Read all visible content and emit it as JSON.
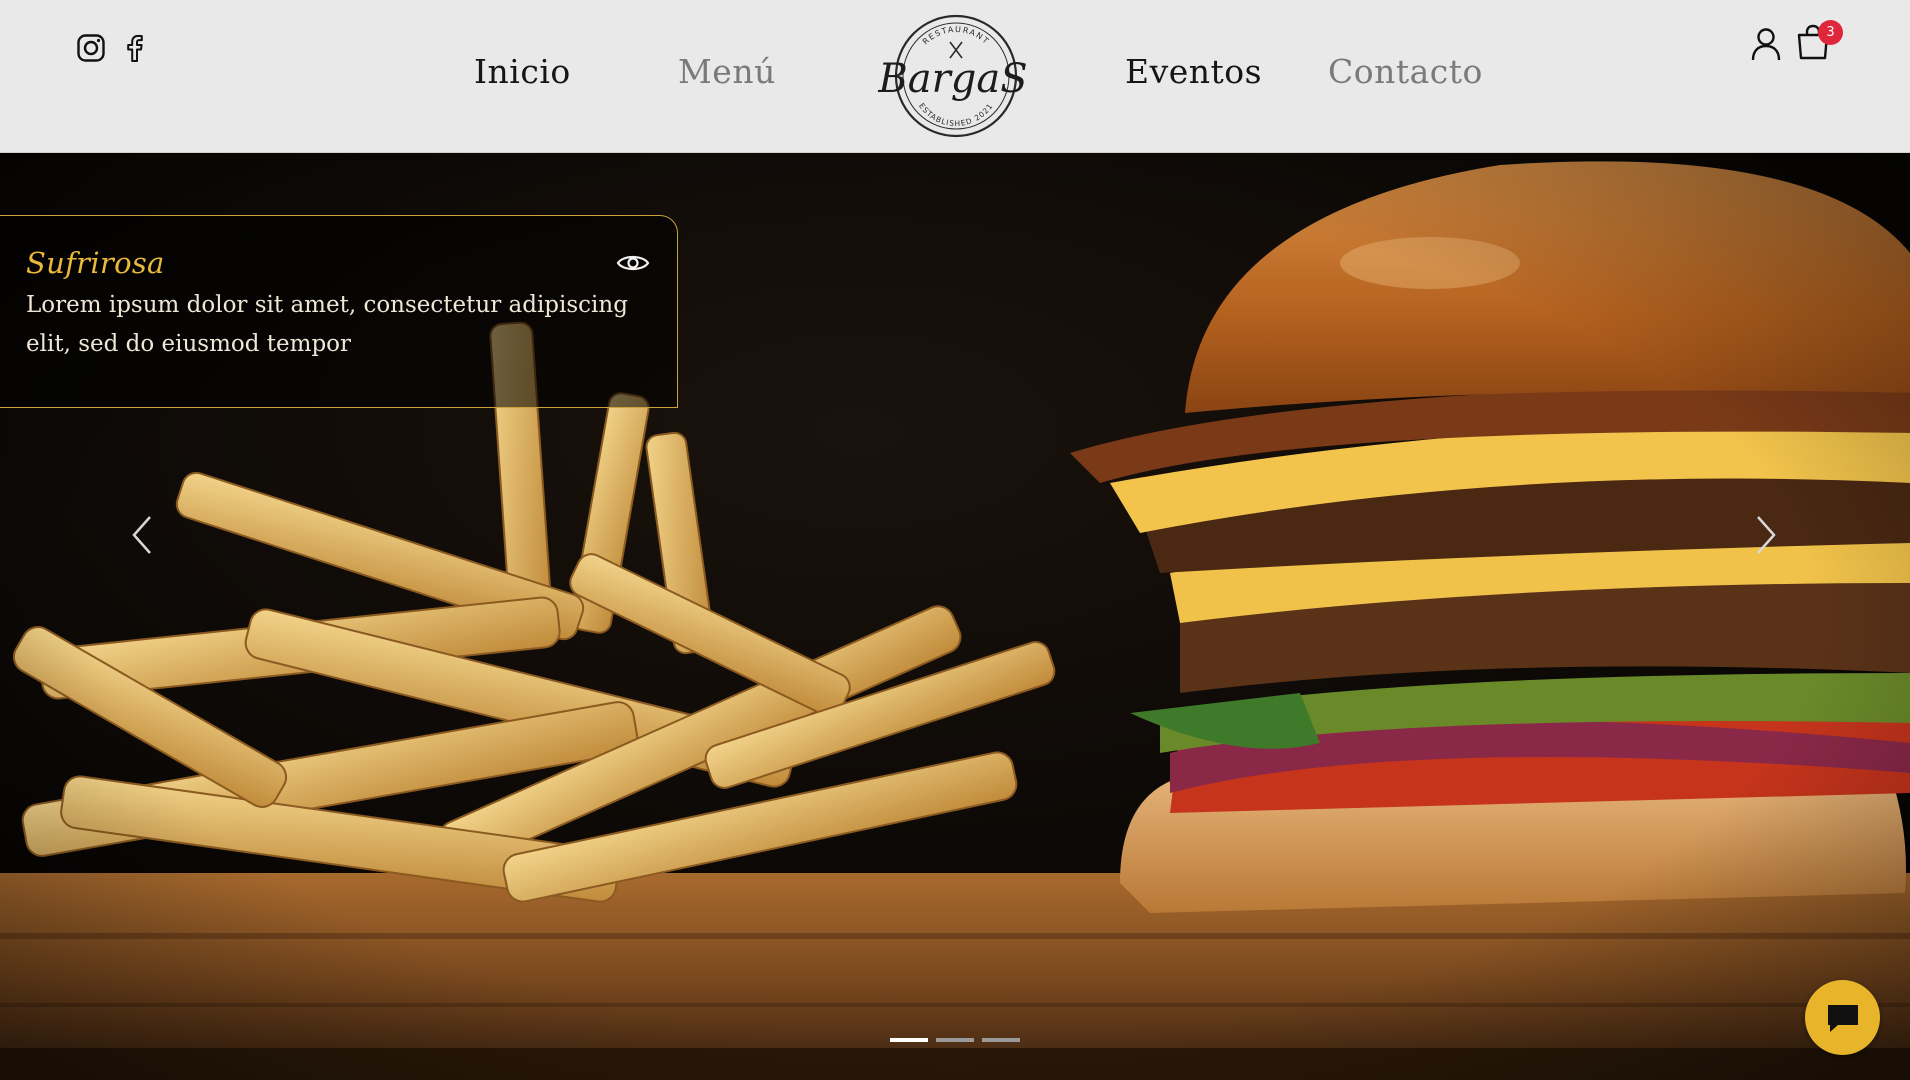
{
  "header": {
    "nav": {
      "inicio": "Inicio",
      "menu": "Menú",
      "eventos": "Eventos",
      "contacto": "Contacto"
    },
    "logo": {
      "name": "BargaS",
      "top_text": "RESTAURANT",
      "bottom_text": "ESTABLISHED 2021"
    },
    "cart_count": "3",
    "social_icons": [
      "instagram-icon",
      "facebook-icon"
    ]
  },
  "hero": {
    "card": {
      "title": "Sufrirosa",
      "text": "Lorem ipsum dolor sit amet, consectetur adipiscing elit, sed do eiusmod tempor"
    },
    "slides_total": 3,
    "active_slide": 1
  },
  "colors": {
    "header_bg": "#e9e9e9",
    "accent_gold": "#e8b93a",
    "badge_red": "#e0263b",
    "chat_yellow": "#e8b52a"
  }
}
